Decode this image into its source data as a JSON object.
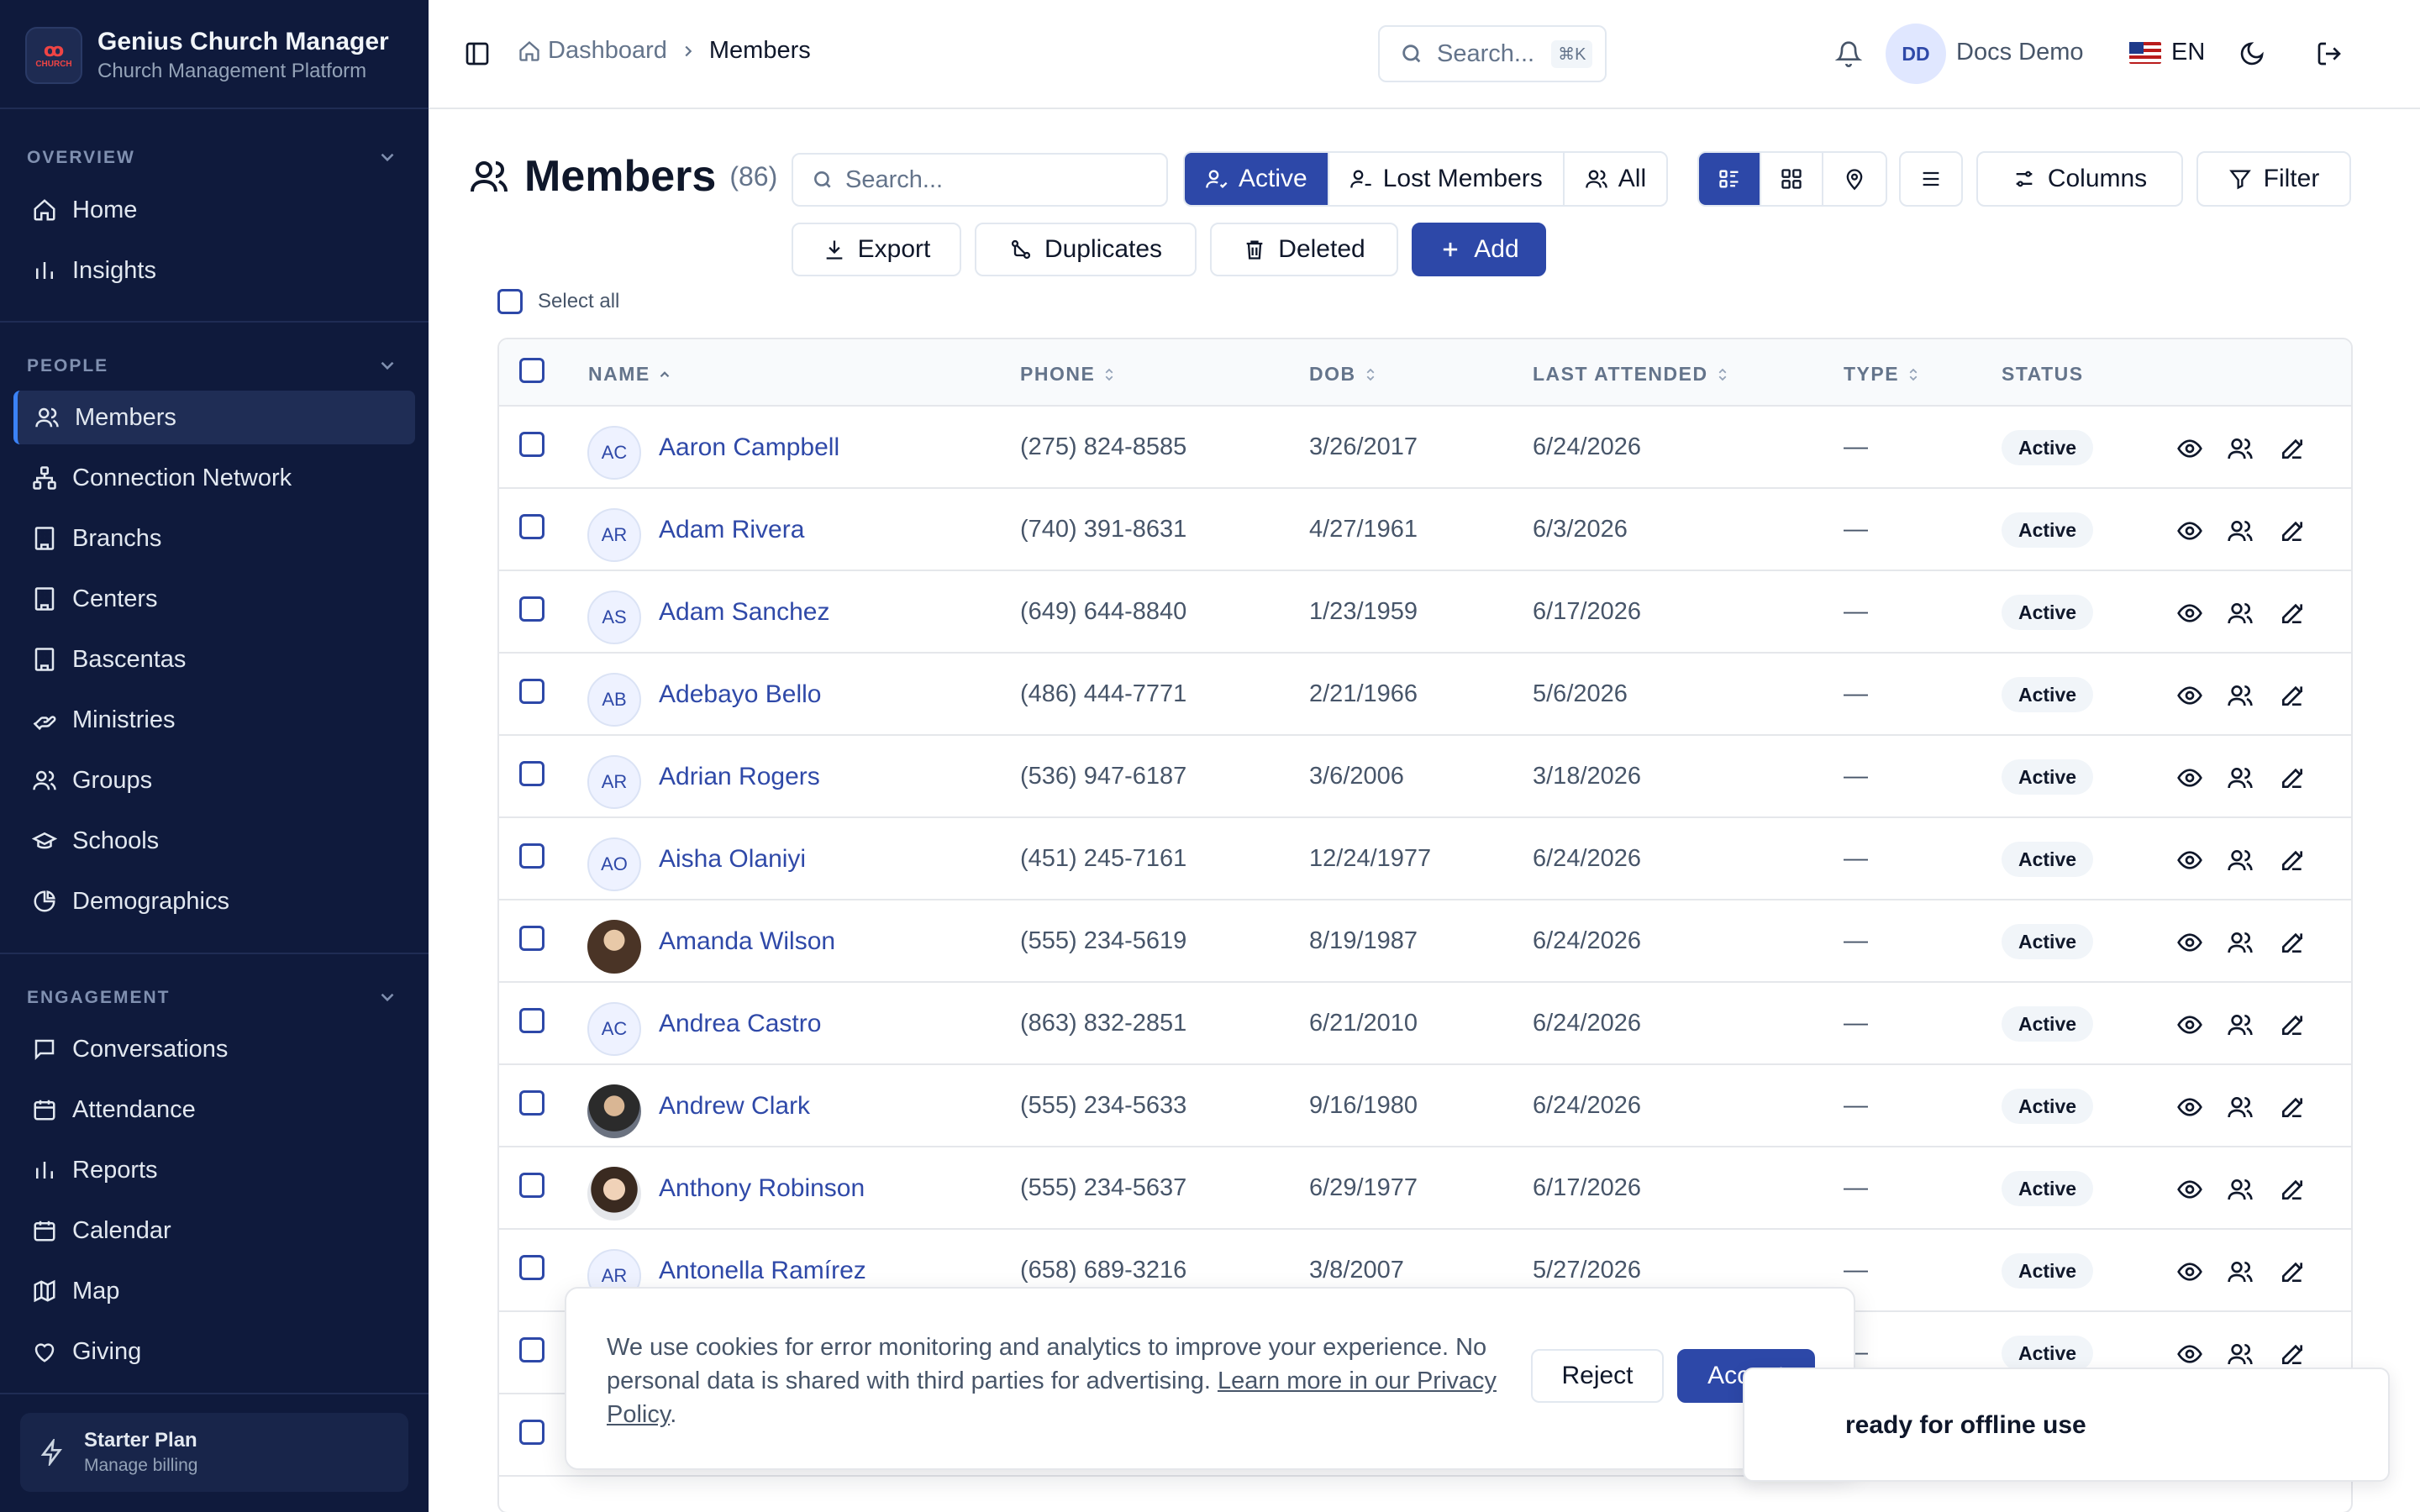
{
  "brand": {
    "title": "Genius Church Manager",
    "subtitle": "Church Management Platform",
    "logo_text": "CHURCH MANAGER"
  },
  "sidebar": {
    "sections": [
      {
        "label": "OVERVIEW",
        "items": [
          {
            "label": "Home",
            "icon": "home-icon"
          },
          {
            "label": "Insights",
            "icon": "bar-chart-icon"
          }
        ]
      },
      {
        "label": "PEOPLE",
        "items": [
          {
            "label": "Members",
            "icon": "users-icon",
            "active": true
          },
          {
            "label": "Connection Network",
            "icon": "network-icon"
          },
          {
            "label": "Branchs",
            "icon": "building-icon"
          },
          {
            "label": "Centers",
            "icon": "building-icon"
          },
          {
            "label": "Bascentas",
            "icon": "building-icon"
          },
          {
            "label": "Ministries",
            "icon": "hand-heart-icon"
          },
          {
            "label": "Groups",
            "icon": "users-icon"
          },
          {
            "label": "Schools",
            "icon": "graduation-cap-icon"
          },
          {
            "label": "Demographics",
            "icon": "pie-chart-icon"
          }
        ]
      },
      {
        "label": "ENGAGEMENT",
        "items": [
          {
            "label": "Conversations",
            "icon": "message-icon"
          },
          {
            "label": "Attendance",
            "icon": "calendar-check-icon"
          },
          {
            "label": "Reports",
            "icon": "bar-chart-icon"
          },
          {
            "label": "Calendar",
            "icon": "calendar-icon"
          },
          {
            "label": "Map",
            "icon": "map-icon"
          },
          {
            "label": "Giving",
            "icon": "heart-icon"
          }
        ]
      }
    ],
    "plan": {
      "title": "Starter Plan",
      "subtitle": "Manage billing"
    }
  },
  "header": {
    "breadcrumb": {
      "home": "Dashboard",
      "current": "Members"
    },
    "search_placeholder": "Search...",
    "search_shortcut": "⌘K",
    "user_initials": "DD",
    "user_name": "Docs Demo",
    "language": "EN"
  },
  "toolbar": {
    "title": "Members",
    "count": "(86)",
    "search_placeholder": "Search...",
    "filters": {
      "active": "Active",
      "lost": "Lost Members",
      "all": "All"
    },
    "columns": "Columns",
    "filter": "Filter",
    "export": "Export",
    "duplicates": "Duplicates",
    "deleted": "Deleted",
    "add": "Add",
    "select_all": "Select all"
  },
  "table": {
    "headers": {
      "name": "NAME",
      "phone": "PHONE",
      "dob": "DOB",
      "last": "LAST ATTENDED",
      "type": "TYPE",
      "status": "STATUS"
    },
    "rows": [
      {
        "initials": "AC",
        "name": "Aaron Campbell",
        "phone": "(275) 824-8585",
        "dob": "3/26/2017",
        "last": "6/24/2026",
        "type": "—",
        "status": "Active"
      },
      {
        "initials": "AR",
        "name": "Adam Rivera",
        "phone": "(740) 391-8631",
        "dob": "4/27/1961",
        "last": "6/3/2026",
        "type": "—",
        "status": "Active"
      },
      {
        "initials": "AS",
        "name": "Adam Sanchez",
        "phone": "(649) 644-8840",
        "dob": "1/23/1959",
        "last": "6/17/2026",
        "type": "—",
        "status": "Active"
      },
      {
        "initials": "AB",
        "name": "Adebayo Bello",
        "phone": "(486) 444-7771",
        "dob": "2/21/1966",
        "last": "5/6/2026",
        "type": "—",
        "status": "Active"
      },
      {
        "initials": "AR",
        "name": "Adrian Rogers",
        "phone": "(536) 947-6187",
        "dob": "3/6/2006",
        "last": "3/18/2026",
        "type": "—",
        "status": "Active"
      },
      {
        "initials": "AO",
        "name": "Aisha Olaniyi",
        "phone": "(451) 245-7161",
        "dob": "12/24/1977",
        "last": "6/24/2026",
        "type": "—",
        "status": "Active"
      },
      {
        "initials": "",
        "photo": "photo",
        "name": "Amanda Wilson",
        "phone": "(555) 234-5619",
        "dob": "8/19/1987",
        "last": "6/24/2026",
        "type": "—",
        "status": "Active"
      },
      {
        "initials": "AC",
        "name": "Andrea Castro",
        "phone": "(863) 832-2851",
        "dob": "6/21/2010",
        "last": "6/24/2026",
        "type": "—",
        "status": "Active"
      },
      {
        "initials": "",
        "photo": "photo2",
        "name": "Andrew Clark",
        "phone": "(555) 234-5633",
        "dob": "9/16/1980",
        "last": "6/24/2026",
        "type": "—",
        "status": "Active"
      },
      {
        "initials": "",
        "photo": "photo3",
        "name": "Anthony Robinson",
        "phone": "(555) 234-5637",
        "dob": "6/29/1977",
        "last": "6/17/2026",
        "type": "—",
        "status": "Active"
      },
      {
        "initials": "AR",
        "name": "Antonella Ramírez",
        "phone": "(658) 689-3216",
        "dob": "3/8/2007",
        "last": "5/27/2026",
        "type": "—",
        "status": "Active"
      },
      {
        "initials": "",
        "name": "",
        "phone": "",
        "dob": "",
        "last": "",
        "type": "—",
        "status": "Active"
      },
      {
        "initials": "",
        "name": "",
        "phone": "",
        "dob": "",
        "last": "",
        "type": "",
        "status": ""
      }
    ]
  },
  "cookie": {
    "text": "We use cookies for error monitoring and analytics to improve your experience. No personal data is shared with third parties for advertising. ",
    "link": "Learn more in our Privacy Policy",
    "link_suffix": ".",
    "reject": "Reject",
    "accept": "Accept"
  },
  "toast": {
    "text": "ready for offline use"
  },
  "colors": {
    "sidebar_bg": "#0f1a3c",
    "primary": "#2d48a8",
    "accent_brand": "#ef4444"
  }
}
